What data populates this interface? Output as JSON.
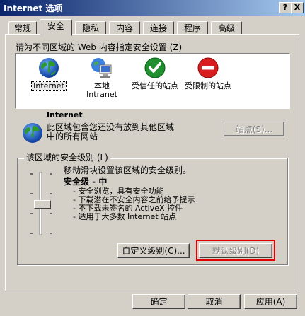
{
  "window": {
    "title": "Internet 选项",
    "help_label": "?",
    "close_label": "X"
  },
  "tabs": [
    {
      "label": "常规",
      "active": false
    },
    {
      "label": "安全",
      "active": true
    },
    {
      "label": "隐私",
      "active": false
    },
    {
      "label": "内容",
      "active": false
    },
    {
      "label": "连接",
      "active": false
    },
    {
      "label": "程序",
      "active": false
    },
    {
      "label": "高级",
      "active": false
    }
  ],
  "security": {
    "zone_prompt": "请为不同区域的 Web 内容指定安全设置 (Z)",
    "zones": [
      {
        "label": "Internet",
        "icon": "globe-icon",
        "selected": true
      },
      {
        "label": "本地 Intranet",
        "icon": "network-computer-icon",
        "selected": false
      },
      {
        "label": "受信任的站点",
        "icon": "green-check-icon",
        "selected": false
      },
      {
        "label": "受限制的站点",
        "icon": "red-restricted-icon",
        "selected": false
      }
    ],
    "selected_zone": {
      "name": "Internet",
      "description_line1": "此区域包含您还没有放到其他区域",
      "description_line2": "中的所有网站",
      "sites_button": "站点(S)..."
    },
    "level_group": {
      "title": "该区域的安全级别 (L)",
      "instruction": "移动滑块设置该区域的安全级别。",
      "level_name": "安全级 - 中",
      "bullets": [
        "- 安全浏览，具有安全功能",
        "- 下载潜在不安全内容之前给予提示",
        "- 不下载未签名的 ActiveX 控件",
        "- 适用于大多数 Internet 站点"
      ],
      "custom_button": "自定义级别(C)...",
      "default_button": "默认级别(D)"
    },
    "slider_level_fraction": 0.5
  },
  "footer": {
    "ok": "确定",
    "cancel": "取消",
    "apply": "应用(A)"
  },
  "colors": {
    "title_start": "#0a246a",
    "title_end": "#a6caf0",
    "highlight_box": "#e00000",
    "face": "#d4d0c8"
  }
}
